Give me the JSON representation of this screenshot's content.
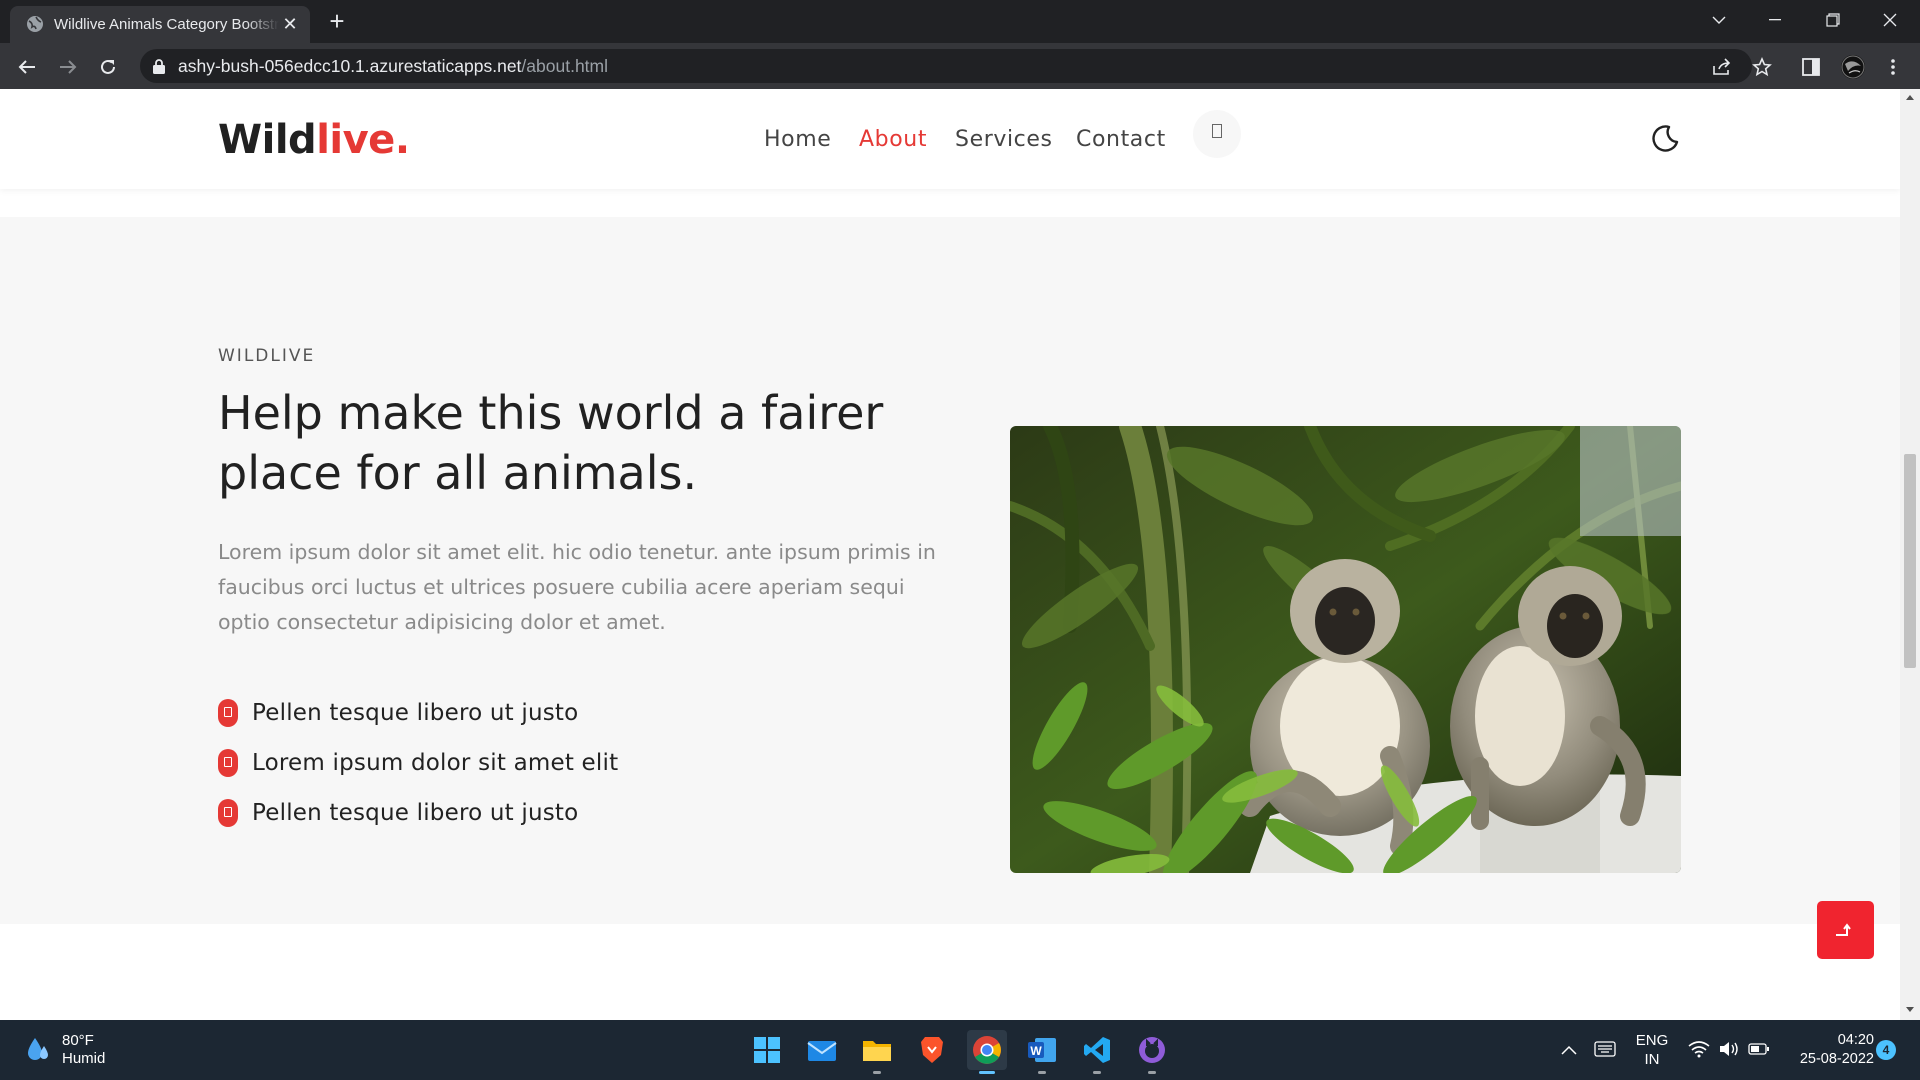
{
  "browser": {
    "tab_title": "Wildlive Animals Category Bootstrap Responsive",
    "url_host": "ashy-bush-056edcc10.1.azurestaticapps.net",
    "url_path": "/about.html"
  },
  "site": {
    "logo_main": "Wild",
    "logo_accent": "live.",
    "nav": [
      {
        "label": "Home"
      },
      {
        "label": "About",
        "active": true
      },
      {
        "label": "Services"
      },
      {
        "label": "Contact"
      }
    ],
    "accent_color": "#e53935"
  },
  "about": {
    "kicker": "WILDLIVE",
    "heading": "Help make this world a fairer place for all animals.",
    "lead": "Lorem ipsum dolor sit amet elit. hic odio tenetur. ante ipsum primis in faucibus orci luctus et ultrices posuere cubilia acere aperiam sequi optio consectetur adipisicing dolor et amet.",
    "bullets": [
      "Pellen tesque libero ut justo",
      "Lorem ipsum dolor sit amet elit",
      "Pellen tesque libero ut justo"
    ]
  },
  "taskbar": {
    "temp": "80°F",
    "condition": "Humid",
    "lang_top": "ENG",
    "lang_bottom": "IN",
    "time": "04:20",
    "date": "25-08-2022",
    "notifications": "4"
  }
}
